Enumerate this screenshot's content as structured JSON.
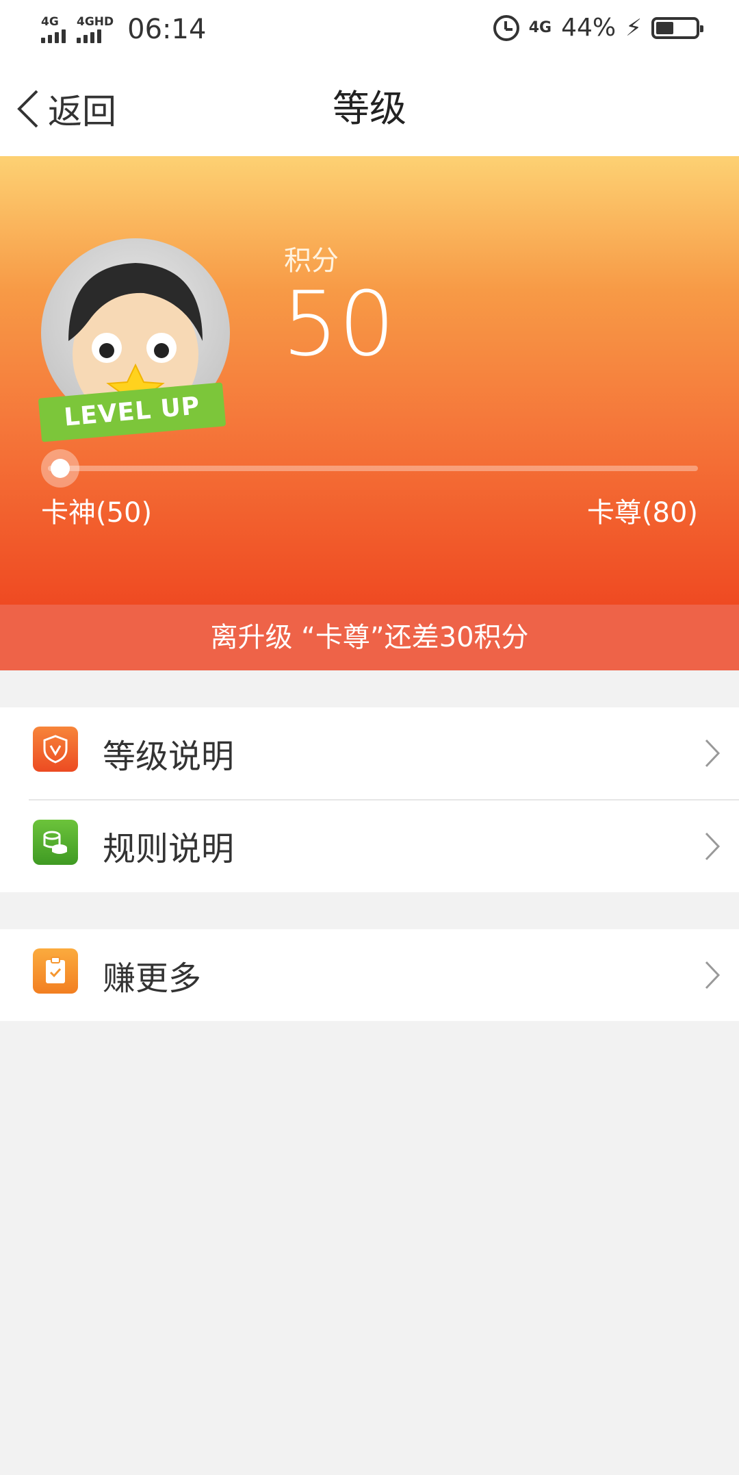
{
  "status_bar": {
    "sim1": "4G",
    "sim2": "4GHD",
    "time": "06:14",
    "network": "4G",
    "battery_percent": "44%",
    "battery_level": 0.44
  },
  "nav": {
    "back_label": "返回",
    "title": "等级"
  },
  "header": {
    "avatar_badge": "LEVEL UP",
    "points_label": "积分",
    "points_value": "50",
    "progress_fraction": 0.0,
    "current_level": "卡神(50)",
    "next_level": "卡尊(80)",
    "upgrade_tip": "离升级 “卡尊”还差30积分"
  },
  "menu": {
    "group1": [
      {
        "label": "等级说明",
        "icon": "shield-v-icon",
        "color": "#f0612b"
      },
      {
        "label": "规则说明",
        "icon": "coins-icon",
        "color": "#52ad2c"
      }
    ],
    "group2": [
      {
        "label": "赚更多",
        "icon": "clipboard-check-icon",
        "color": "#f5962e"
      }
    ]
  }
}
